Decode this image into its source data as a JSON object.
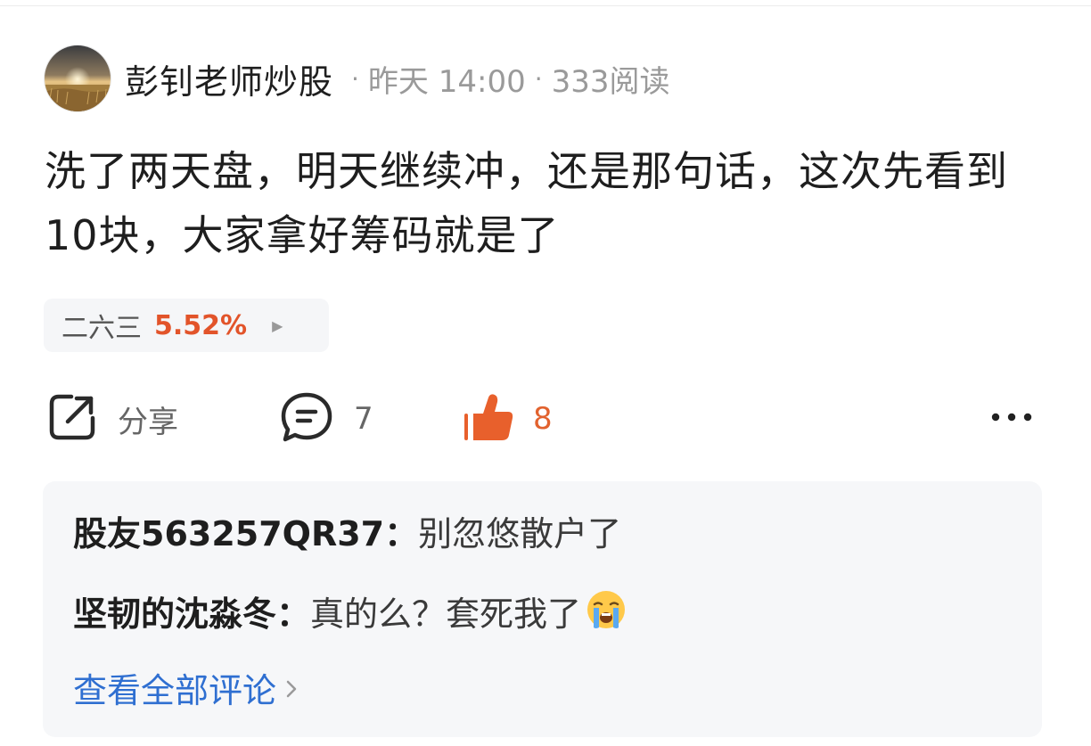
{
  "post": {
    "author": "彭钊老师炒股",
    "time": "昨天 14:00",
    "reads": "333阅读",
    "dot": "·",
    "body": "洗了两天盘，明天继续冲，还是那句话，这次先看到10块，大家拿好筹码就是了"
  },
  "stock": {
    "name": "二六三",
    "change": "5.52%",
    "change_color": "#e2542a"
  },
  "actions": {
    "share_label": "分享",
    "comment_count": "7",
    "like_count": "8",
    "like_color": "#e8602c",
    "icons": [
      "share-icon",
      "comment-icon",
      "thumbs-up-icon",
      "more-icon"
    ]
  },
  "comments": {
    "items": [
      {
        "user": "股友563257QR37",
        "separator": "：",
        "text": "别忽悠散户了"
      },
      {
        "user": "坚韧的沈淼冬",
        "separator": "：",
        "text": "真的么？套死我了",
        "emoji": "loudly-crying-face-icon"
      }
    ],
    "view_all": "查看全部评论"
  }
}
